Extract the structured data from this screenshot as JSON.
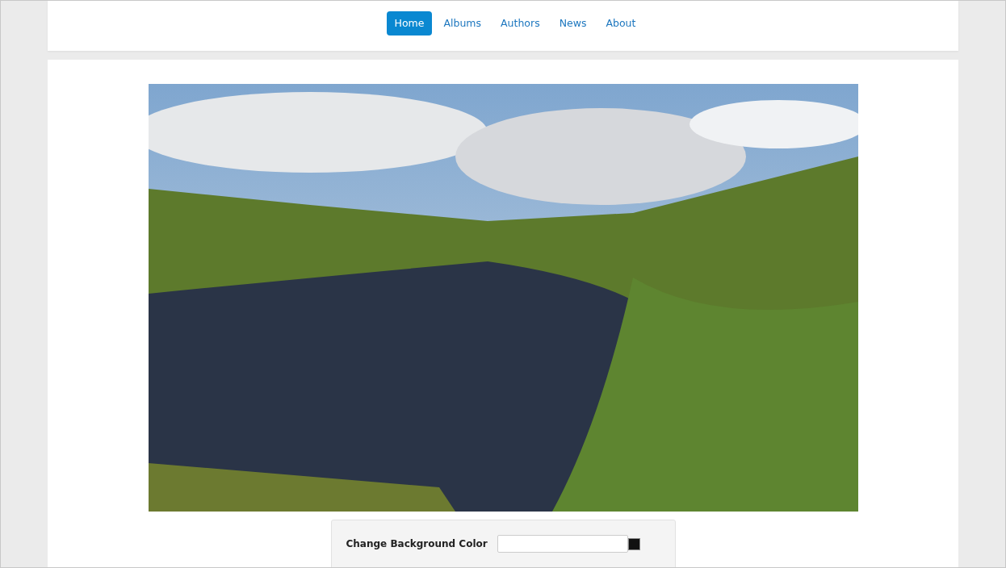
{
  "nav": {
    "items": [
      {
        "label": "Home",
        "selected": true
      },
      {
        "label": "Albums",
        "selected": false
      },
      {
        "label": "Authors",
        "selected": false
      },
      {
        "label": "News",
        "selected": false
      },
      {
        "label": "About",
        "selected": false
      }
    ]
  },
  "settings": {
    "label": "Change Background Color"
  }
}
